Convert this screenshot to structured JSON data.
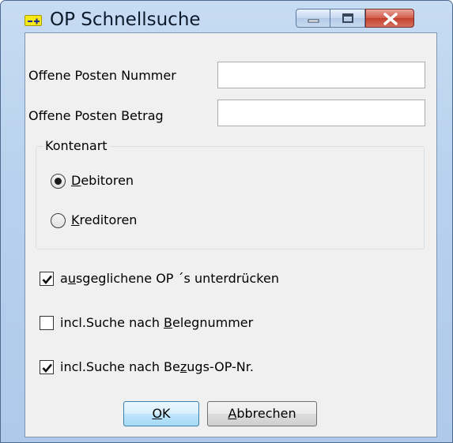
{
  "window": {
    "title": "OP Schnellsuche"
  },
  "fields": {
    "op_number_label": "Offene Posten Nummer",
    "op_number_value": "",
    "op_amount_label": "Offene Posten Betrag",
    "op_amount_value": ""
  },
  "account_type": {
    "legend": "Kontenart",
    "options": [
      {
        "accel": "D",
        "rest": "ebitoren",
        "label": "Debitoren",
        "selected": true
      },
      {
        "accel": "K",
        "rest": "reditoren",
        "label": "Kreditoren",
        "selected": false
      }
    ]
  },
  "options": [
    {
      "pre": "a",
      "accel": "u",
      "post": "sgeglichene OP ´s unterdrücken",
      "label": "ausgeglichene OP ´s unterdrücken",
      "checked": true
    },
    {
      "pre": "incl.Suche nach ",
      "accel": "B",
      "post": "elegnummer",
      "label": "incl.Suche nach Belegnummer",
      "checked": false
    },
    {
      "pre": "incl.Suche nach Be",
      "accel": "z",
      "post": "ugs-OP-Nr.",
      "label": "incl.Suche nach Bezugs-OP-Nr.",
      "checked": true
    }
  ],
  "buttons": {
    "ok": {
      "accel": "O",
      "rest": "K",
      "label": "OK"
    },
    "cancel": {
      "accel": "A",
      "rest": "bbrechen",
      "label": "Abbrechen"
    }
  },
  "icons": {
    "app": "app-icon",
    "minimize": "minimize-icon",
    "maximize": "maximize-icon",
    "close": "close-icon"
  }
}
